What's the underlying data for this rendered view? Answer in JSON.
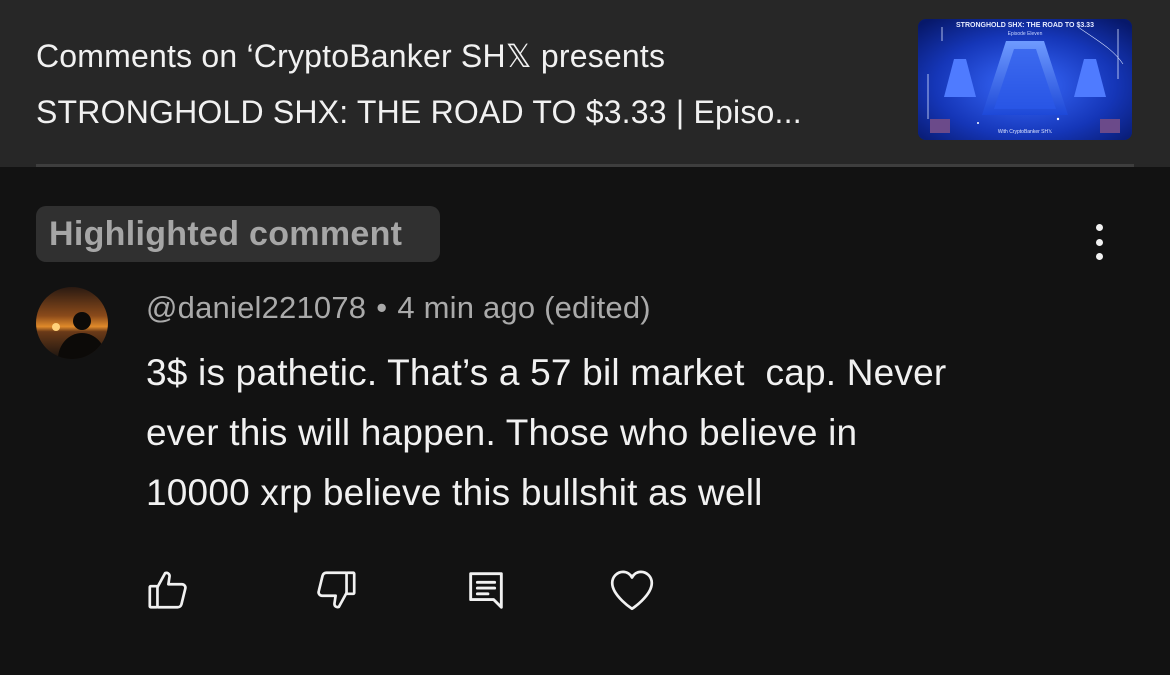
{
  "header": {
    "title_line1": "Comments on ‘CryptoBanker SH𝕏 presents",
    "title_line2": "STRONGHOLD SHX: THE ROAD TO $3.33 | Episo...",
    "thumbnail": {
      "title": "STRONGHOLD SHX: THE ROAD TO $3.33",
      "subtitle": "Episode Eleven",
      "footer": "With CryptoBanker SH𝕏"
    }
  },
  "badge": {
    "label": "Highlighted comment"
  },
  "comment": {
    "author": "@daniel221078",
    "separator": "•",
    "timestamp": "4 min ago (edited)",
    "lines": [
      "3$ is pathetic. That’s a 57 bil market  cap. Never",
      "ever this will happen. Those who believe in",
      "10000 xrp believe this bullshit as well"
    ]
  },
  "actions": [
    {
      "icon": "thumbs-up-icon"
    },
    {
      "icon": "thumbs-down-icon"
    },
    {
      "icon": "reply-icon"
    },
    {
      "icon": "heart-icon"
    }
  ],
  "colors": {
    "background": "#121212",
    "header_background": "#272727",
    "badge_background": "#303030",
    "primary_text": "#f1f1f1",
    "secondary_text": "#aaaaaa"
  }
}
